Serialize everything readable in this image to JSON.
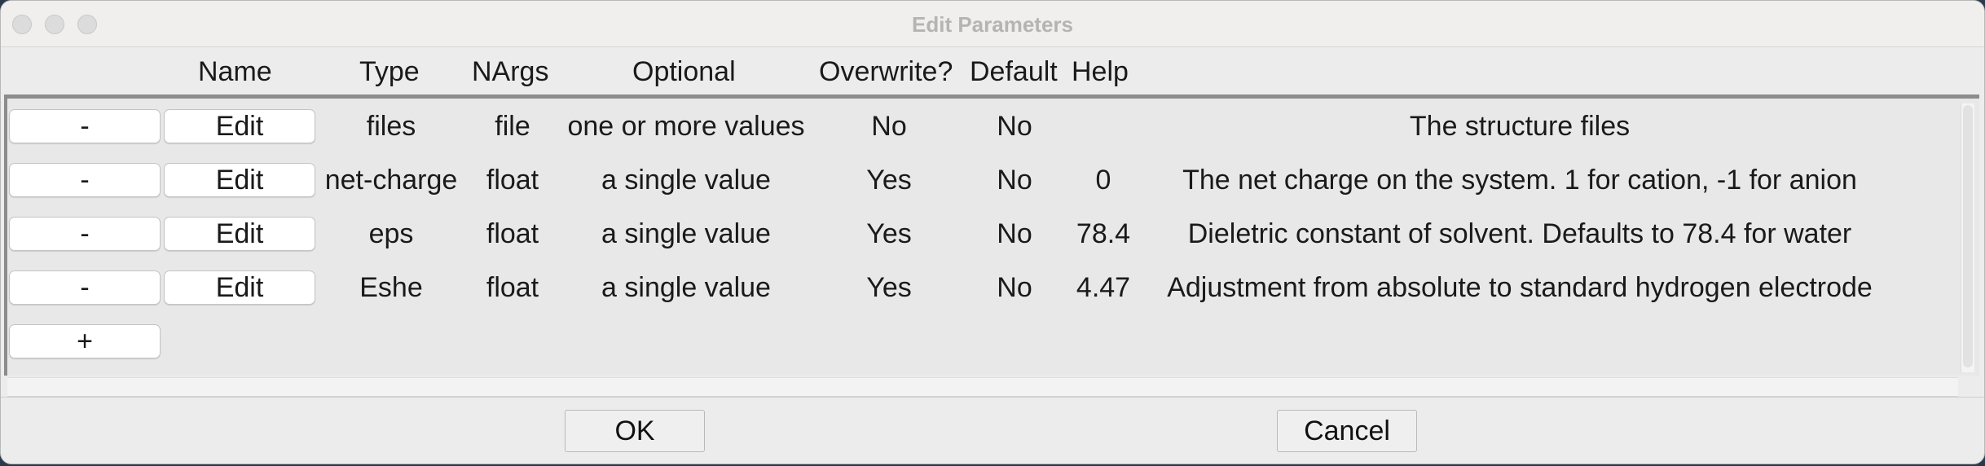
{
  "window": {
    "title": "Edit Parameters"
  },
  "columns": {
    "name": "Name",
    "type": "Type",
    "nargs": "NArgs",
    "optional": "Optional",
    "overwrite": "Overwrite?",
    "default": "Default",
    "help": "Help"
  },
  "row_buttons": {
    "remove": "-",
    "edit": "Edit",
    "add": "+"
  },
  "rows": [
    {
      "name": "files",
      "type": "file",
      "nargs": "one or more values",
      "optional": "No",
      "overwrite": "No",
      "default": "",
      "help": "The structure files"
    },
    {
      "name": "net-charge",
      "type": "float",
      "nargs": "a single value",
      "optional": "Yes",
      "overwrite": "No",
      "default": "0",
      "help": "The net charge on the system. 1 for cation, -1 for anion"
    },
    {
      "name": "eps",
      "type": "float",
      "nargs": "a single value",
      "optional": "Yes",
      "overwrite": "No",
      "default": "78.4",
      "help": "Dieletric constant of solvent. Defaults to 78.4 for water"
    },
    {
      "name": "Eshe",
      "type": "float",
      "nargs": "a single value",
      "optional": "Yes",
      "overwrite": "No",
      "default": "4.47",
      "help": "Adjustment from absolute to standard hydrogen electrode"
    }
  ],
  "dialog": {
    "ok": "OK",
    "cancel": "Cancel"
  }
}
